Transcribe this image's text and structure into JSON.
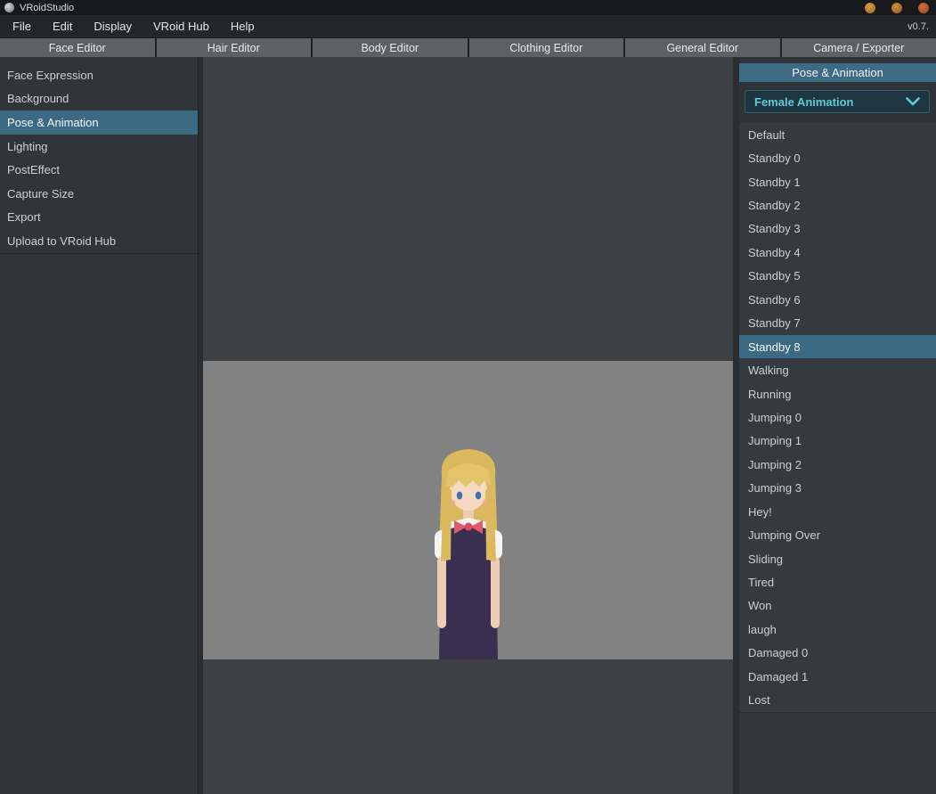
{
  "window": {
    "title": "VRoidStudio",
    "version": "v0.7."
  },
  "menu": {
    "items": [
      {
        "label": "File"
      },
      {
        "label": "Edit"
      },
      {
        "label": "Display"
      },
      {
        "label": "VRoid Hub"
      },
      {
        "label": "Help"
      }
    ]
  },
  "tabs": [
    {
      "label": "Face Editor"
    },
    {
      "label": "Hair Editor"
    },
    {
      "label": "Body Editor"
    },
    {
      "label": "Clothing Editor"
    },
    {
      "label": "General Editor"
    },
    {
      "label": "Camera / Exporter"
    }
  ],
  "sidebar": {
    "items": [
      {
        "label": "Face Expression",
        "selected": false
      },
      {
        "label": "Background",
        "selected": false
      },
      {
        "label": "Pose & Animation",
        "selected": true
      },
      {
        "label": "Lighting",
        "selected": false
      },
      {
        "label": "PostEffect",
        "selected": false
      },
      {
        "label": "Capture Size",
        "selected": false
      },
      {
        "label": "Export",
        "selected": false
      },
      {
        "label": "Upload to VRoid Hub",
        "selected": false
      }
    ]
  },
  "right_panel": {
    "title": "Pose & Animation",
    "dropdown_value": "Female Animation",
    "animations": [
      {
        "label": "Default",
        "selected": false
      },
      {
        "label": "Standby 0",
        "selected": false
      },
      {
        "label": "Standby 1",
        "selected": false
      },
      {
        "label": "Standby 2",
        "selected": false
      },
      {
        "label": "Standby 3",
        "selected": false
      },
      {
        "label": "Standby 4",
        "selected": false
      },
      {
        "label": "Standby 5",
        "selected": false
      },
      {
        "label": "Standby 6",
        "selected": false
      },
      {
        "label": "Standby 7",
        "selected": false
      },
      {
        "label": "Standby 8",
        "selected": true
      },
      {
        "label": "Walking",
        "selected": false
      },
      {
        "label": "Running",
        "selected": false
      },
      {
        "label": "Jumping 0",
        "selected": false
      },
      {
        "label": "Jumping 1",
        "selected": false
      },
      {
        "label": "Jumping 2",
        "selected": false
      },
      {
        "label": "Jumping 3",
        "selected": false
      },
      {
        "label": "Hey!",
        "selected": false
      },
      {
        "label": "Jumping Over",
        "selected": false
      },
      {
        "label": "Sliding",
        "selected": false
      },
      {
        "label": "Tired",
        "selected": false
      },
      {
        "label": "Won",
        "selected": false
      },
      {
        "label": "laugh",
        "selected": false
      },
      {
        "label": "Damaged 0",
        "selected": false
      },
      {
        "label": "Damaged 1",
        "selected": false
      },
      {
        "label": "Lost",
        "selected": false
      }
    ]
  },
  "icons": {
    "app": "vroid-logo",
    "dropdown_chevron": "chevron-down",
    "window_controls": [
      "minimize",
      "maximize",
      "close"
    ]
  },
  "colors": {
    "selection_accent": "#3d6a83",
    "panel_header": "#3d6b83",
    "dropdown_accent": "#5fc9da",
    "tab_background": "#5b6167",
    "viewport_dark": "#3d4144",
    "viewport_light": "#828282",
    "sidebar_background": "#30353a"
  }
}
